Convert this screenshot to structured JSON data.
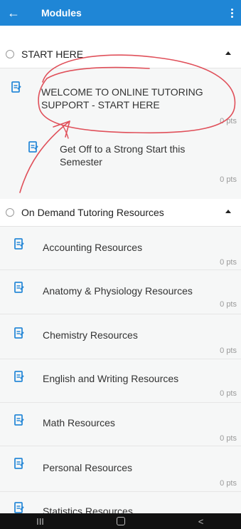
{
  "app_bar": {
    "back_icon": "arrow-left-icon",
    "title": "Modules",
    "menu_icon": "more-vertical-icon",
    "color": "#1f86d6"
  },
  "modules": [
    {
      "name": "START HERE",
      "items": [
        {
          "title": "WELCOME TO ONLINE TUTORING SUPPORT - START HERE",
          "points": "0 pts",
          "icon": "page-icon"
        },
        {
          "title": "Get Off to a Strong Start this Semester",
          "points": "0 pts",
          "icon": "page-icon"
        }
      ]
    },
    {
      "name": "On Demand Tutoring Resources",
      "items": [
        {
          "title": "Accounting Resources",
          "points": "0 pts",
          "icon": "page-icon"
        },
        {
          "title": "Anatomy & Physiology Resources",
          "points": "0 pts",
          "icon": "page-icon"
        },
        {
          "title": "Chemistry Resources",
          "points": "0 pts",
          "icon": "page-icon"
        },
        {
          "title": "English and Writing Resources",
          "points": "0 pts",
          "icon": "page-icon"
        },
        {
          "title": "Math Resources",
          "points": "0 pts",
          "icon": "page-icon"
        },
        {
          "title": "Personal Resources",
          "points": "0 pts",
          "icon": "page-icon"
        },
        {
          "title": "Statistics Resources",
          "points": "",
          "icon": "page-icon"
        }
      ]
    }
  ],
  "nav_bar": {
    "recents_label": "III",
    "home_icon": "home-icon",
    "back_label": "<"
  },
  "annotation_color": "#e0505a",
  "icon_color": "#2a8ad8"
}
